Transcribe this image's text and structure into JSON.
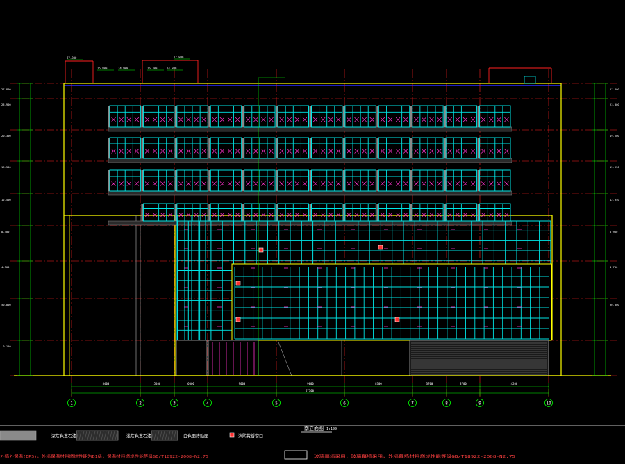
{
  "drawing": {
    "title": "南立面图",
    "title_scale": "1:100",
    "colors": {
      "background": "#000000",
      "outline": "#ffff00",
      "mullion": "#00e5e5",
      "axis": "#ff2020",
      "floor_line": "#2a2aff",
      "panel": "#ff33cc",
      "dimension": "#00ff00",
      "grey": "#8a8a8a",
      "text": "#ffffff"
    },
    "axes": [
      {
        "label": "1"
      },
      {
        "label": "2"
      },
      {
        "label": "3"
      },
      {
        "label": "4"
      },
      {
        "label": "5"
      },
      {
        "label": "6"
      },
      {
        "label": "7"
      },
      {
        "label": "8"
      },
      {
        "label": "9"
      },
      {
        "label": "10"
      }
    ],
    "spans": [
      "8400",
      "5400",
      "6000",
      "9000",
      "9000",
      "8700",
      "3700",
      "3700",
      "4200"
    ],
    "total_width": "57300",
    "elevations": [
      "27.800",
      "23.900",
      "20.300",
      "16.500",
      "12.500",
      "8.400",
      "4.500",
      "±0.000",
      "-0.150"
    ],
    "roof_labels": [
      "27.800",
      "25.800",
      "24.900",
      "27.800",
      "26.300",
      "24.800"
    ],
    "right_labels": [
      "27.800",
      "23.300",
      "19.600",
      "15.950",
      "12.950",
      "8.950",
      "4.700",
      "±0.000"
    ],
    "legend": [
      {
        "label": "深灰色真石漆",
        "swatch": "grey"
      },
      {
        "label": "浅灰色真石漆",
        "swatch": "hatch"
      },
      {
        "label": "白色面砖贴面",
        "swatch": "hatch"
      },
      {
        "label": "消防救援窗口",
        "swatch": "red-box"
      }
    ],
    "notes": [
      "外墙外保温(EPS)，外墙保温材料燃烧性能为B1级，保温材料燃烧性能等级GB/T18922-2008-N2.75",
      "玻璃幕墙采用，玻璃幕墙采用，外墙幕墙材料燃烧性能等级GB/T18922-2008-N2.75"
    ]
  }
}
